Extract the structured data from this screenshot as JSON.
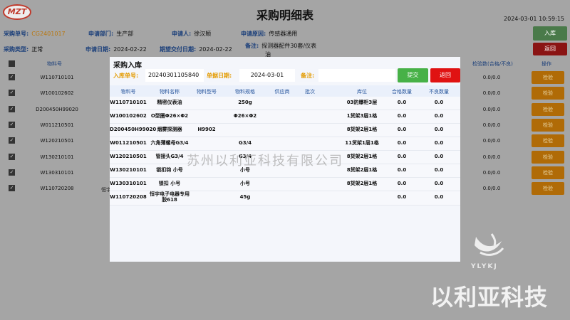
{
  "header": {
    "logo_text": "MZT",
    "title": "采购明细表",
    "datetime": "2024-03-01 10:59:15",
    "inbound_btn": "入库",
    "back_btn": "返回"
  },
  "info": {
    "order_no_label": "采购单号:",
    "order_no": "CG2401017",
    "dept_label": "申请部门:",
    "dept": "生产部",
    "applicant_label": "申请人:",
    "applicant": "徐汉颖",
    "reason_label": "申请原因:",
    "reason": "传感器通用",
    "type_label": "采购类型:",
    "type": "正常",
    "apply_date_label": "申请日期:",
    "apply_date": "2024-02-22",
    "delivery_label": "期望交付日期:",
    "delivery": "2024-02-22",
    "remark_label": "备注:",
    "remark_line1": "探测器配件30套/仪表",
    "remark_line2": "油"
  },
  "grid": {
    "headers": {
      "material_no": "物料号",
      "qty": "检验数(合格/不良)",
      "action": "操作"
    },
    "rows": [
      {
        "code": "W110710101",
        "qty": "0.0/0.0",
        "action": "检验"
      },
      {
        "code": "W100102602",
        "qty": "0.0/0.0",
        "action": "检验"
      },
      {
        "code": "D200450H99020",
        "qty": "0.0/0.0",
        "action": "检验"
      },
      {
        "code": "W011210501",
        "qty": "0.0/0.0",
        "action": "检验"
      },
      {
        "code": "W120210501",
        "qty": "0.0/0.0",
        "action": "检验"
      },
      {
        "code": "W130210101",
        "qty": "0.0/0.0",
        "action": "检验"
      },
      {
        "code": "W130310101",
        "qty": "0.0/0.0",
        "action": "检验"
      },
      {
        "code": "W110720208",
        "qty": "0.0/0.0",
        "action": "检验"
      }
    ],
    "side_text": "恒宇"
  },
  "modal": {
    "title": "采购入库",
    "inbound_no_label": "入库单号:",
    "inbound_no": "20240301105840",
    "doc_date_label": "单据日期:",
    "doc_date": "2024-03-01",
    "remark_label": "备注:",
    "submit_btn": "提交",
    "back_btn": "返回",
    "columns": {
      "code": "物料号",
      "name": "物料名称",
      "model": "物料型号",
      "spec": "物料规格",
      "supplier": "供应商",
      "batch": "批次",
      "location": "库位",
      "ok_qty": "合格数量",
      "ng_qty": "不良数量"
    },
    "rows": [
      {
        "code": "W110710101",
        "name": "精密仪表油",
        "model": "",
        "spec": "250g",
        "supplier": "",
        "batch": "",
        "location": "03防爆柜3层",
        "ok": "0.0",
        "ng": "0.0"
      },
      {
        "code": "W100102602",
        "name": "O型圈Φ26×Φ2",
        "model": "",
        "spec": "Φ26×Φ2",
        "supplier": "",
        "batch": "",
        "location": "1货架3层1格",
        "ok": "0.0",
        "ng": "0.0"
      },
      {
        "code": "D200450H99020",
        "name": "烟雾探测器",
        "model": "H9902",
        "spec": "",
        "supplier": "",
        "batch": "",
        "location": "8货架2层1格",
        "ok": "0.0",
        "ng": "0.0"
      },
      {
        "code": "W011210501",
        "name": "六角薄螺母G3/4",
        "model": "",
        "spec": "G3/4",
        "supplier": "",
        "batch": "",
        "location": "11货架1层1格",
        "ok": "0.0",
        "ng": "0.0"
      },
      {
        "code": "W120210501",
        "name": "管接头G3/4",
        "model": "",
        "spec": "G3/4",
        "supplier": "",
        "batch": "",
        "location": "8货架2层1格",
        "ok": "0.0",
        "ng": "0.0"
      },
      {
        "code": "W130210101",
        "name": "锁扣钩 小号",
        "model": "",
        "spec": "小号",
        "supplier": "",
        "batch": "",
        "location": "8货架2层1格",
        "ok": "0.0",
        "ng": "0.0"
      },
      {
        "code": "W130310101",
        "name": "锁扣 小号",
        "model": "",
        "spec": "小号",
        "supplier": "",
        "batch": "",
        "location": "8货架2层1格",
        "ok": "0.0",
        "ng": "0.0"
      },
      {
        "code": "W110720208",
        "name": "恒宇电子电器专用胶618",
        "model": "",
        "spec": "45g",
        "supplier": "",
        "batch": "",
        "location": "",
        "ok": "0.0",
        "ng": "0.0"
      }
    ]
  },
  "overlay": {
    "watermark": "苏州以利亚科技有限公司",
    "brand_sub": "YLYKJ",
    "brand_text": "以利亚科技"
  }
}
